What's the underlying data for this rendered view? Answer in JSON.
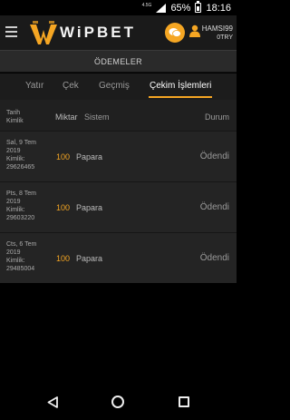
{
  "status_bar": {
    "network": "4.5G",
    "battery_percent": "65%",
    "time": "18:16"
  },
  "header": {
    "logo_text": "WiPBET",
    "username": "HAMSI99",
    "balance": "0TRY"
  },
  "page": {
    "title": "ÖDEMELER"
  },
  "tabs": [
    {
      "label": "Yatır",
      "active": false
    },
    {
      "label": "Çek",
      "active": false
    },
    {
      "label": "Geçmiş",
      "active": false
    },
    {
      "label": "Çekim İşlemleri",
      "active": true
    }
  ],
  "table": {
    "headers": {
      "date_line1": "Tarih",
      "date_line2": "Kimlik",
      "amount": "Miktar",
      "system": "Sistem",
      "status": "Durum"
    },
    "rows": [
      {
        "day": "Sal, 9 Tem",
        "year": "2019",
        "id_label": "Kimlik:",
        "id": "29626465",
        "amount": "100",
        "system": "Papara",
        "status": "Ödendi"
      },
      {
        "day": "Pts, 8 Tem",
        "year": "2019",
        "id_label": "Kimlik:",
        "id": "29603220",
        "amount": "100",
        "system": "Papara",
        "status": "Ödendi"
      },
      {
        "day": "Cts, 6 Tem",
        "year": "2019",
        "id_label": "Kimlik:",
        "id": "29485004",
        "amount": "100",
        "system": "Papara",
        "status": "Ödendi"
      }
    ]
  },
  "colors": {
    "accent": "#f5a623",
    "background": "#000000",
    "header": "#1a1a1a"
  },
  "icons": [
    "hamburger-menu-icon",
    "chat-icon",
    "user-icon",
    "back-icon",
    "home-icon",
    "recent-apps-icon"
  ]
}
